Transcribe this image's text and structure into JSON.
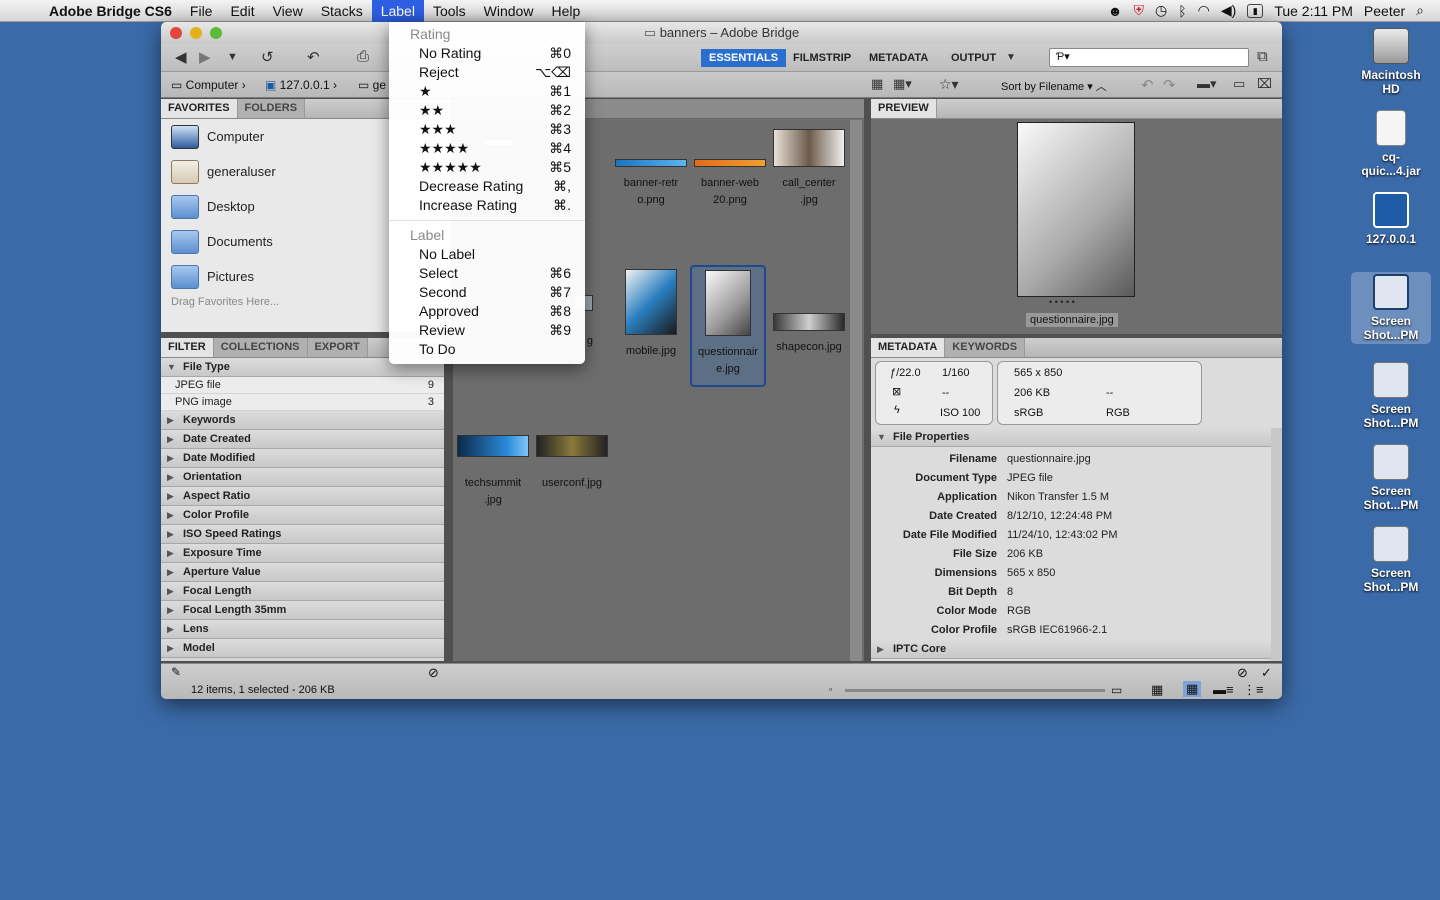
{
  "menubar": {
    "app_name": "Adobe Bridge CS6",
    "items": [
      "File",
      "Edit",
      "View",
      "Stacks",
      "Label",
      "Tools",
      "Window",
      "Help"
    ],
    "active": "Label",
    "clock": "Tue 2:11 PM",
    "user": "Peeter"
  },
  "window": {
    "title": "banners – Adobe Bridge",
    "path": [
      "Computer",
      "127.0.0.1",
      "ge"
    ],
    "workspaces": [
      "ESSENTIALS",
      "FILMSTRIP",
      "METADATA",
      "OUTPUT"
    ],
    "active_workspace": "ESSENTIALS",
    "sort": "Sort by Filename",
    "search_placeholder": "Ƥ▾"
  },
  "favorites": {
    "tabs": [
      "FAVORITES",
      "FOLDERS"
    ],
    "items": [
      "Computer",
      "generaluser",
      "Desktop",
      "Documents",
      "Pictures"
    ],
    "drag_hint": "Drag Favorites Here..."
  },
  "filter": {
    "tabs": [
      "FILTER",
      "COLLECTIONS",
      "EXPORT"
    ],
    "file_type_label": "File Type",
    "file_types": [
      {
        "name": "JPEG file",
        "count": "9"
      },
      {
        "name": "PNG image",
        "count": "3"
      }
    ],
    "categories": [
      "Keywords",
      "Date Created",
      "Date Modified",
      "Orientation",
      "Aspect Ratio",
      "Color Profile",
      "ISO Speed Ratings",
      "Exposure Time",
      "Aperture Value",
      "Focal Length",
      "Focal Length 35mm",
      "Lens",
      "Model"
    ]
  },
  "content": {
    "thumbs": [
      {
        "name": "non",
        "caption2": ""
      },
      {
        "name": "banner-retr",
        "caption2": "o.png"
      },
      {
        "name": "banner-web",
        "caption2": "20.png"
      },
      {
        "name": "call_center",
        "caption2": ".jpg"
      },
      {
        "name": "g",
        "caption2": ""
      },
      {
        "name": "mobile.jpg",
        "caption2": ""
      },
      {
        "name": "questionnair",
        "caption2": "e.jpg"
      },
      {
        "name": "shapecon.jpg",
        "caption2": ""
      },
      {
        "name": "techsummit",
        "caption2": ".jpg"
      },
      {
        "name": "userconf.jpg",
        "caption2": ""
      }
    ]
  },
  "preview": {
    "tab": "PREVIEW",
    "caption": "questionnaire.jpg",
    "dots": "• • • • •"
  },
  "metadata": {
    "tabs": [
      "METADATA",
      "KEYWORDS"
    ],
    "summary": {
      "fnumber": "ƒ/22.0",
      "shutter": "1/160",
      "dims": "565 x 850",
      "size": "206 KB",
      "dash1": "--",
      "dash2": "--",
      "iso": "ISO 100",
      "cspace": "sRGB",
      "mode": "RGB"
    },
    "section": "File Properties",
    "props": [
      {
        "k": "Filename",
        "v": "questionnaire.jpg"
      },
      {
        "k": "Document Type",
        "v": "JPEG file"
      },
      {
        "k": "Application",
        "v": "Nikon Transfer 1.5 M"
      },
      {
        "k": "Date Created",
        "v": "8/12/10, 12:24:48 PM"
      },
      {
        "k": "Date File Modified",
        "v": "11/24/10, 12:43:02 PM"
      },
      {
        "k": "File Size",
        "v": "206 KB"
      },
      {
        "k": "Dimensions",
        "v": "565 x 850"
      },
      {
        "k": "Bit Depth",
        "v": "8"
      },
      {
        "k": "Color Mode",
        "v": "RGB"
      },
      {
        "k": "Color Profile",
        "v": "sRGB IEC61966-2.1"
      }
    ],
    "section2": "IPTC Core"
  },
  "status": "12 items, 1 selected - 206 KB",
  "label_menu": {
    "rating_header": "Rating",
    "rating_items": [
      {
        "label": "No Rating",
        "sc": "⌘0"
      },
      {
        "label": "Reject",
        "sc": "⌥⌫"
      },
      {
        "label": "★",
        "sc": "⌘1"
      },
      {
        "label": "★★",
        "sc": "⌘2"
      },
      {
        "label": "★★★",
        "sc": "⌘3"
      },
      {
        "label": "★★★★",
        "sc": "⌘4"
      },
      {
        "label": "★★★★★",
        "sc": "⌘5"
      },
      {
        "label": "Decrease Rating",
        "sc": "⌘,"
      },
      {
        "label": "Increase Rating",
        "sc": "⌘."
      }
    ],
    "label_header": "Label",
    "label_items": [
      {
        "label": "No Label",
        "sc": ""
      },
      {
        "label": "Select",
        "sc": "⌘6"
      },
      {
        "label": "Second",
        "sc": "⌘7"
      },
      {
        "label": "Approved",
        "sc": "⌘8"
      },
      {
        "label": "Review",
        "sc": "⌘9"
      },
      {
        "label": "To Do",
        "sc": ""
      }
    ]
  },
  "desktop": [
    {
      "l1": "Macintosh",
      "l2": "HD"
    },
    {
      "l1": "cq-",
      "l2": "quic...4.jar"
    },
    {
      "l1": "127.0.0.1",
      "l2": ""
    },
    {
      "l1": "Screen",
      "l2": "Shot...PM"
    },
    {
      "l1": "Screen",
      "l2": "Shot...PM"
    },
    {
      "l1": "Screen",
      "l2": "Shot...PM"
    },
    {
      "l1": "Screen",
      "l2": "Shot...PM"
    }
  ]
}
